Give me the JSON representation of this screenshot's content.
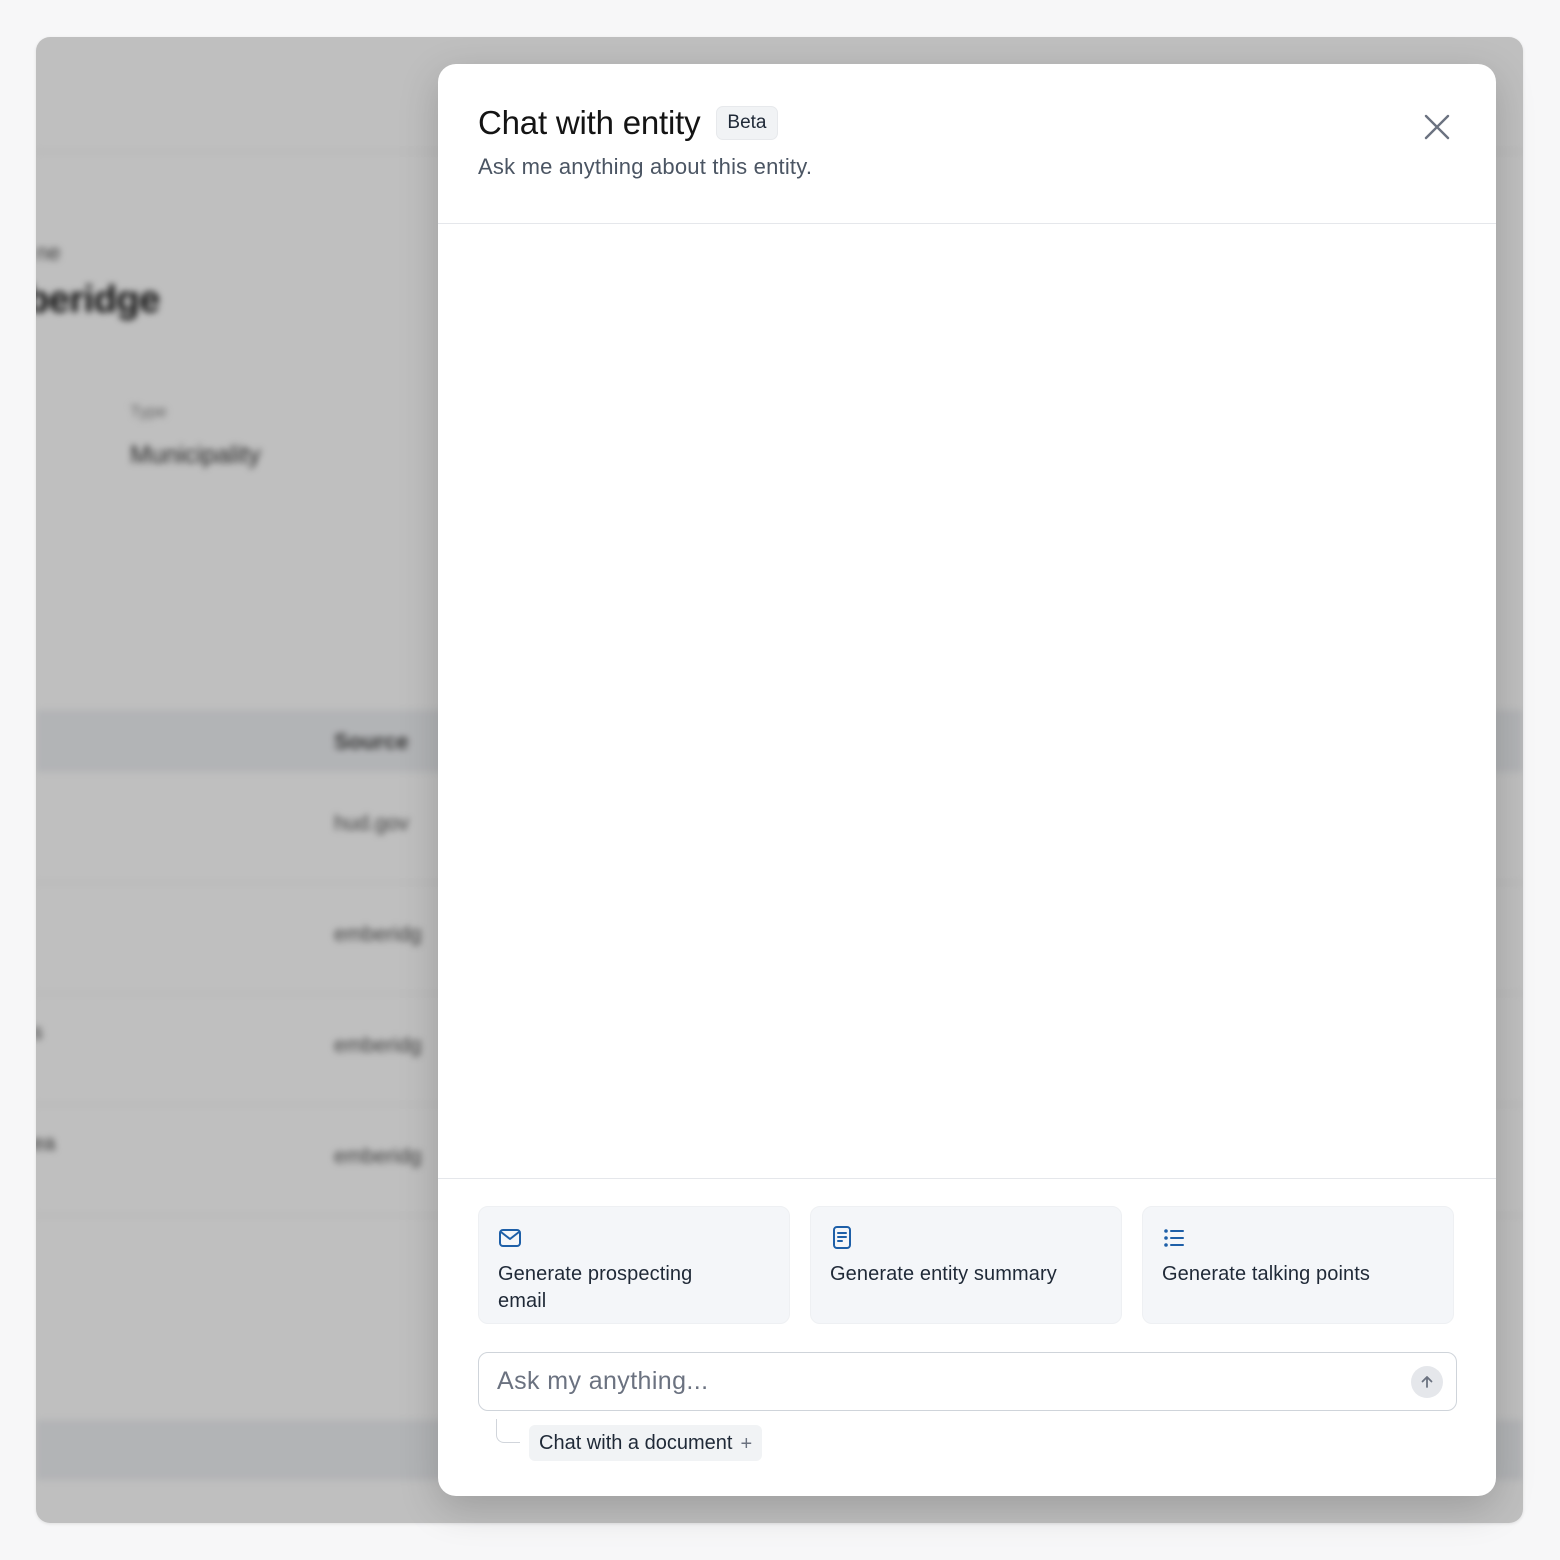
{
  "background": {
    "entity_label_fragment": "ne",
    "entity_name_fragment": "beridge",
    "type_label": "Type",
    "type_value": "Municipality",
    "table": {
      "source_header": "Source",
      "source_cells": [
        "hud.gov",
        "emberidg",
        "emberidg",
        "emberidg"
      ],
      "row_label_fragments": [
        "",
        "",
        "s",
        "ea"
      ]
    }
  },
  "modal": {
    "title": "Chat with entity",
    "badge": "Beta",
    "subtitle": "Ask me anything about this entity.",
    "actions": [
      {
        "label": "Generate prospecting email",
        "icon": "mail-icon"
      },
      {
        "label": "Generate entity summary",
        "icon": "document-icon"
      },
      {
        "label": "Generate talking points",
        "icon": "list-icon"
      }
    ],
    "input": {
      "placeholder": "Ask my anything...",
      "value": ""
    },
    "doc_chip": {
      "label": "Chat with a document",
      "icon": "plus-icon"
    },
    "colors": {
      "accent": "#1d5fa8",
      "card_bg": "#f4f6f9",
      "border": "#e5e7eb"
    }
  }
}
